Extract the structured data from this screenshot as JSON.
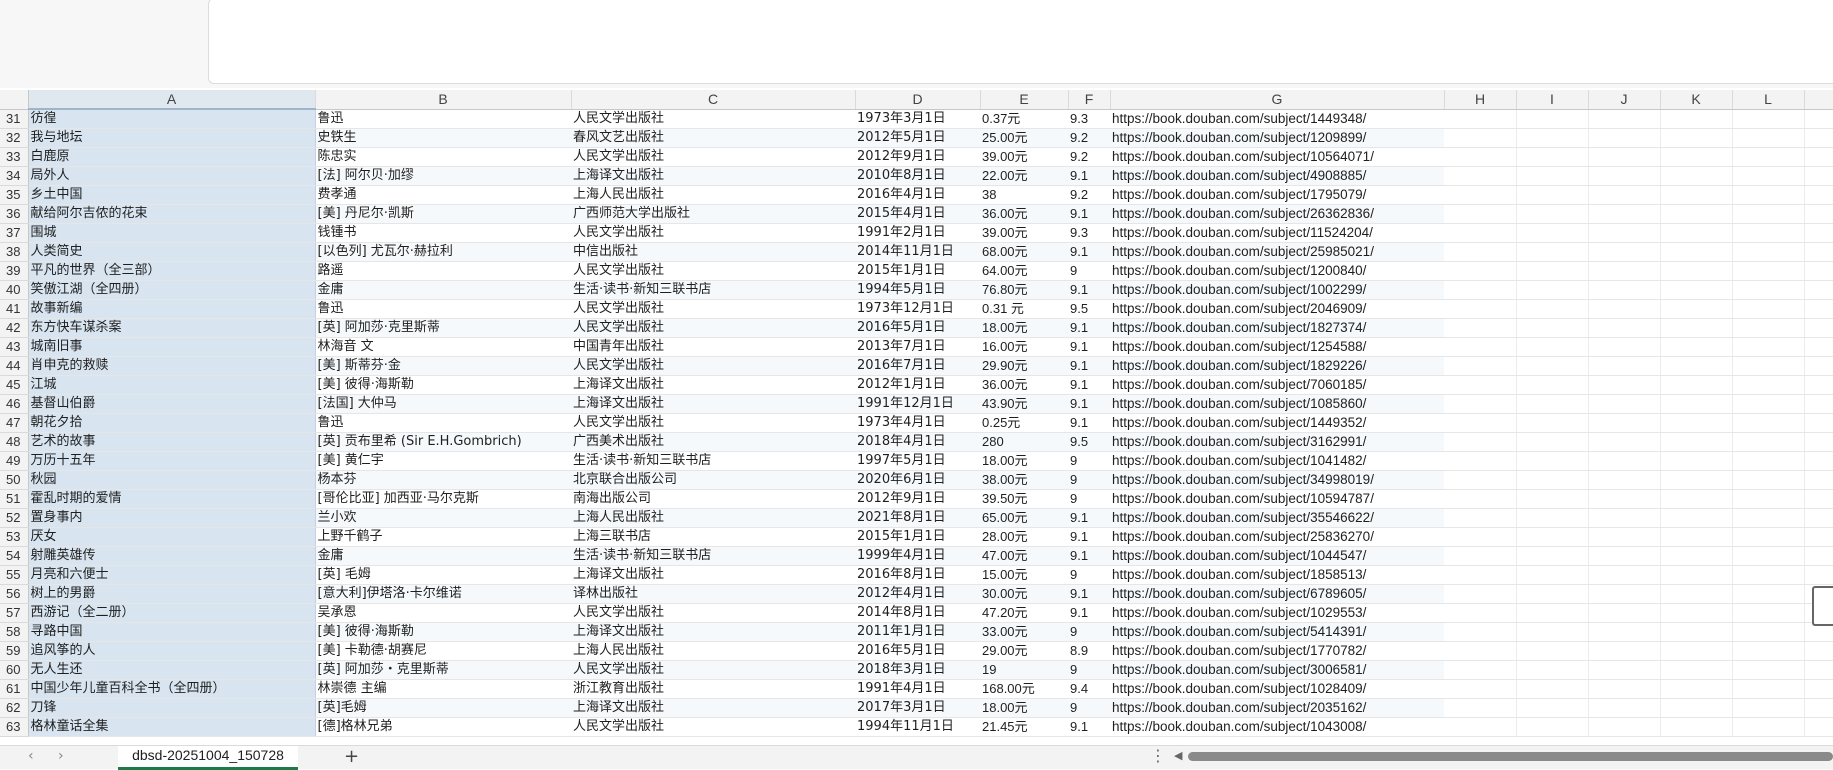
{
  "columns": [
    "A",
    "B",
    "C",
    "D",
    "E",
    "F",
    "G",
    "H",
    "I",
    "J",
    "K",
    "L"
  ],
  "rows": [
    [
      "31",
      "彷徨",
      "鲁迅",
      "人民文学出版社",
      "1973年3月1日",
      "0.37元",
      "9.3",
      "https://book.douban.com/subject/1449348/"
    ],
    [
      "32",
      "我与地坛",
      "史铁生",
      "春风文艺出版社",
      "2012年5月1日",
      "25.00元",
      "9.2",
      "https://book.douban.com/subject/1209899/"
    ],
    [
      "33",
      "白鹿原",
      "陈忠实",
      "人民文学出版社",
      "2012年9月1日",
      "39.00元",
      "9.2",
      "https://book.douban.com/subject/10564071/"
    ],
    [
      "34",
      "局外人",
      "[法] 阿尔贝·加缪",
      "上海译文出版社",
      "2010年8月1日",
      "22.00元",
      "9.1",
      "https://book.douban.com/subject/4908885/"
    ],
    [
      "35",
      "乡土中国",
      "费孝通",
      "上海人民出版社",
      "2016年4月1日",
      "38",
      "9.2",
      "https://book.douban.com/subject/1795079/"
    ],
    [
      "36",
      "献给阿尔吉侬的花束",
      "[美] 丹尼尔·凯斯",
      "广西师范大学出版社",
      "2015年4月1日",
      "36.00元",
      "9.1",
      "https://book.douban.com/subject/26362836/"
    ],
    [
      "37",
      "围城",
      "钱锺书",
      "人民文学出版社",
      "1991年2月1日",
      "39.00元",
      "9.3",
      "https://book.douban.com/subject/11524204/"
    ],
    [
      "38",
      "人类简史",
      "[以色列] 尤瓦尔·赫拉利",
      "中信出版社",
      "2014年11月1日",
      "68.00元",
      "9.1",
      "https://book.douban.com/subject/25985021/"
    ],
    [
      "39",
      "平凡的世界（全三部）",
      "路遥",
      "人民文学出版社",
      "2015年1月1日",
      "64.00元",
      "9",
      "https://book.douban.com/subject/1200840/"
    ],
    [
      "40",
      "笑傲江湖（全四册）",
      "金庸",
      "生活·读书·新知三联书店",
      "1994年5月1日",
      "76.80元",
      "9.1",
      "https://book.douban.com/subject/1002299/"
    ],
    [
      "41",
      "故事新编",
      "鲁迅",
      "人民文学出版社",
      "1973年12月1日",
      "0.31 元",
      "9.5",
      "https://book.douban.com/subject/2046909/"
    ],
    [
      "42",
      "东方快车谋杀案",
      "[英] 阿加莎·克里斯蒂",
      "人民文学出版社",
      "2016年5月1日",
      "18.00元",
      "9.1",
      "https://book.douban.com/subject/1827374/"
    ],
    [
      "43",
      "城南旧事",
      "林海音 文",
      "中国青年出版社",
      "2013年7月1日",
      "16.00元",
      "9.1",
      "https://book.douban.com/subject/1254588/"
    ],
    [
      "44",
      "肖申克的救赎",
      "[美] 斯蒂芬·金",
      "人民文学出版社",
      "2016年7月1日",
      "29.90元",
      "9.1",
      "https://book.douban.com/subject/1829226/"
    ],
    [
      "45",
      "江城",
      "[美] 彼得·海斯勒",
      "上海译文出版社",
      "2012年1月1日",
      "36.00元",
      "9.1",
      "https://book.douban.com/subject/7060185/"
    ],
    [
      "46",
      "基督山伯爵",
      "[法国] 大仲马",
      "上海译文出版社",
      "1991年12月1日",
      "43.90元",
      "9.1",
      "https://book.douban.com/subject/1085860/"
    ],
    [
      "47",
      "朝花夕拾",
      "鲁迅",
      "人民文学出版社",
      "1973年4月1日",
      "0.25元",
      "9.1",
      "https://book.douban.com/subject/1449352/"
    ],
    [
      "48",
      "艺术的故事",
      "[英] 贡布里希 (Sir E.H.Gombrich)",
      "广西美术出版社",
      "2018年4月1日",
      "280",
      "9.5",
      "https://book.douban.com/subject/3162991/"
    ],
    [
      "49",
      "万历十五年",
      "[美] 黄仁宇",
      "生活·读书·新知三联书店",
      "1997年5月1日",
      "18.00元",
      "9",
      "https://book.douban.com/subject/1041482/"
    ],
    [
      "50",
      "秋园",
      "杨本芬",
      "北京联合出版公司",
      "2020年6月1日",
      "38.00元",
      "9",
      "https://book.douban.com/subject/34998019/"
    ],
    [
      "51",
      "霍乱时期的爱情",
      "[哥伦比亚] 加西亚·马尔克斯",
      "南海出版公司",
      "2012年9月1日",
      "39.50元",
      "9",
      "https://book.douban.com/subject/10594787/"
    ],
    [
      "52",
      "置身事内",
      "兰小欢",
      "上海人民出版社",
      "2021年8月1日",
      "65.00元",
      "9.1",
      "https://book.douban.com/subject/35546622/"
    ],
    [
      "53",
      "厌女",
      "上野千鹤子",
      "上海三联书店",
      "2015年1月1日",
      "28.00元",
      "9.1",
      "https://book.douban.com/subject/25836270/"
    ],
    [
      "54",
      "射雕英雄传",
      "金庸",
      "生活·读书·新知三联书店",
      "1999年4月1日",
      "47.00元",
      "9.1",
      "https://book.douban.com/subject/1044547/"
    ],
    [
      "55",
      "月亮和六便士",
      "[英] 毛姆",
      "上海译文出版社",
      "2016年8月1日",
      "15.00元",
      "9",
      "https://book.douban.com/subject/1858513/"
    ],
    [
      "56",
      "树上的男爵",
      "[意大利]伊塔洛·卡尔维诺",
      "译林出版社",
      "2012年4月1日",
      "30.00元",
      "9.1",
      "https://book.douban.com/subject/6789605/"
    ],
    [
      "57",
      "西游记（全二册）",
      "吴承恩",
      "人民文学出版社",
      "2014年8月1日",
      "47.20元",
      "9.1",
      "https://book.douban.com/subject/1029553/"
    ],
    [
      "58",
      "寻路中国",
      "[美] 彼得·海斯勒",
      "上海译文出版社",
      "2011年1月1日",
      "33.00元",
      "9",
      "https://book.douban.com/subject/5414391/"
    ],
    [
      "59",
      "追风筝的人",
      "[美] 卡勒德·胡赛尼",
      "上海人民出版社",
      "2016年5月1日",
      "29.00元",
      "8.9",
      "https://book.douban.com/subject/1770782/"
    ],
    [
      "60",
      "无人生还",
      "[英] 阿加莎・克里斯蒂",
      "人民文学出版社",
      "2018年3月1日",
      "19",
      "9",
      "https://book.douban.com/subject/3006581/"
    ],
    [
      "61",
      "中国少年儿童百科全书（全四册）",
      "林崇德 主编",
      "浙江教育出版社",
      "1991年4月1日",
      "168.00元",
      "9.4",
      "https://book.douban.com/subject/1028409/"
    ],
    [
      "62",
      "刀锋",
      "[英]毛姆",
      "上海译文出版社",
      "2017年3月1日",
      "18.00元",
      "9",
      "https://book.douban.com/subject/2035162/"
    ],
    [
      "63",
      "格林童话全集",
      "[德]格林兄弟",
      "人民文学出版社",
      "1994年11月1日",
      "21.45元",
      "9.1",
      "https://book.douban.com/subject/1043008/"
    ]
  ],
  "sheet_tab": "dbsd-20251004_150728",
  "tabbar": {
    "prev": "‹",
    "next": "›",
    "add": "+",
    "more": "⋮",
    "scroll_left": "◀"
  }
}
